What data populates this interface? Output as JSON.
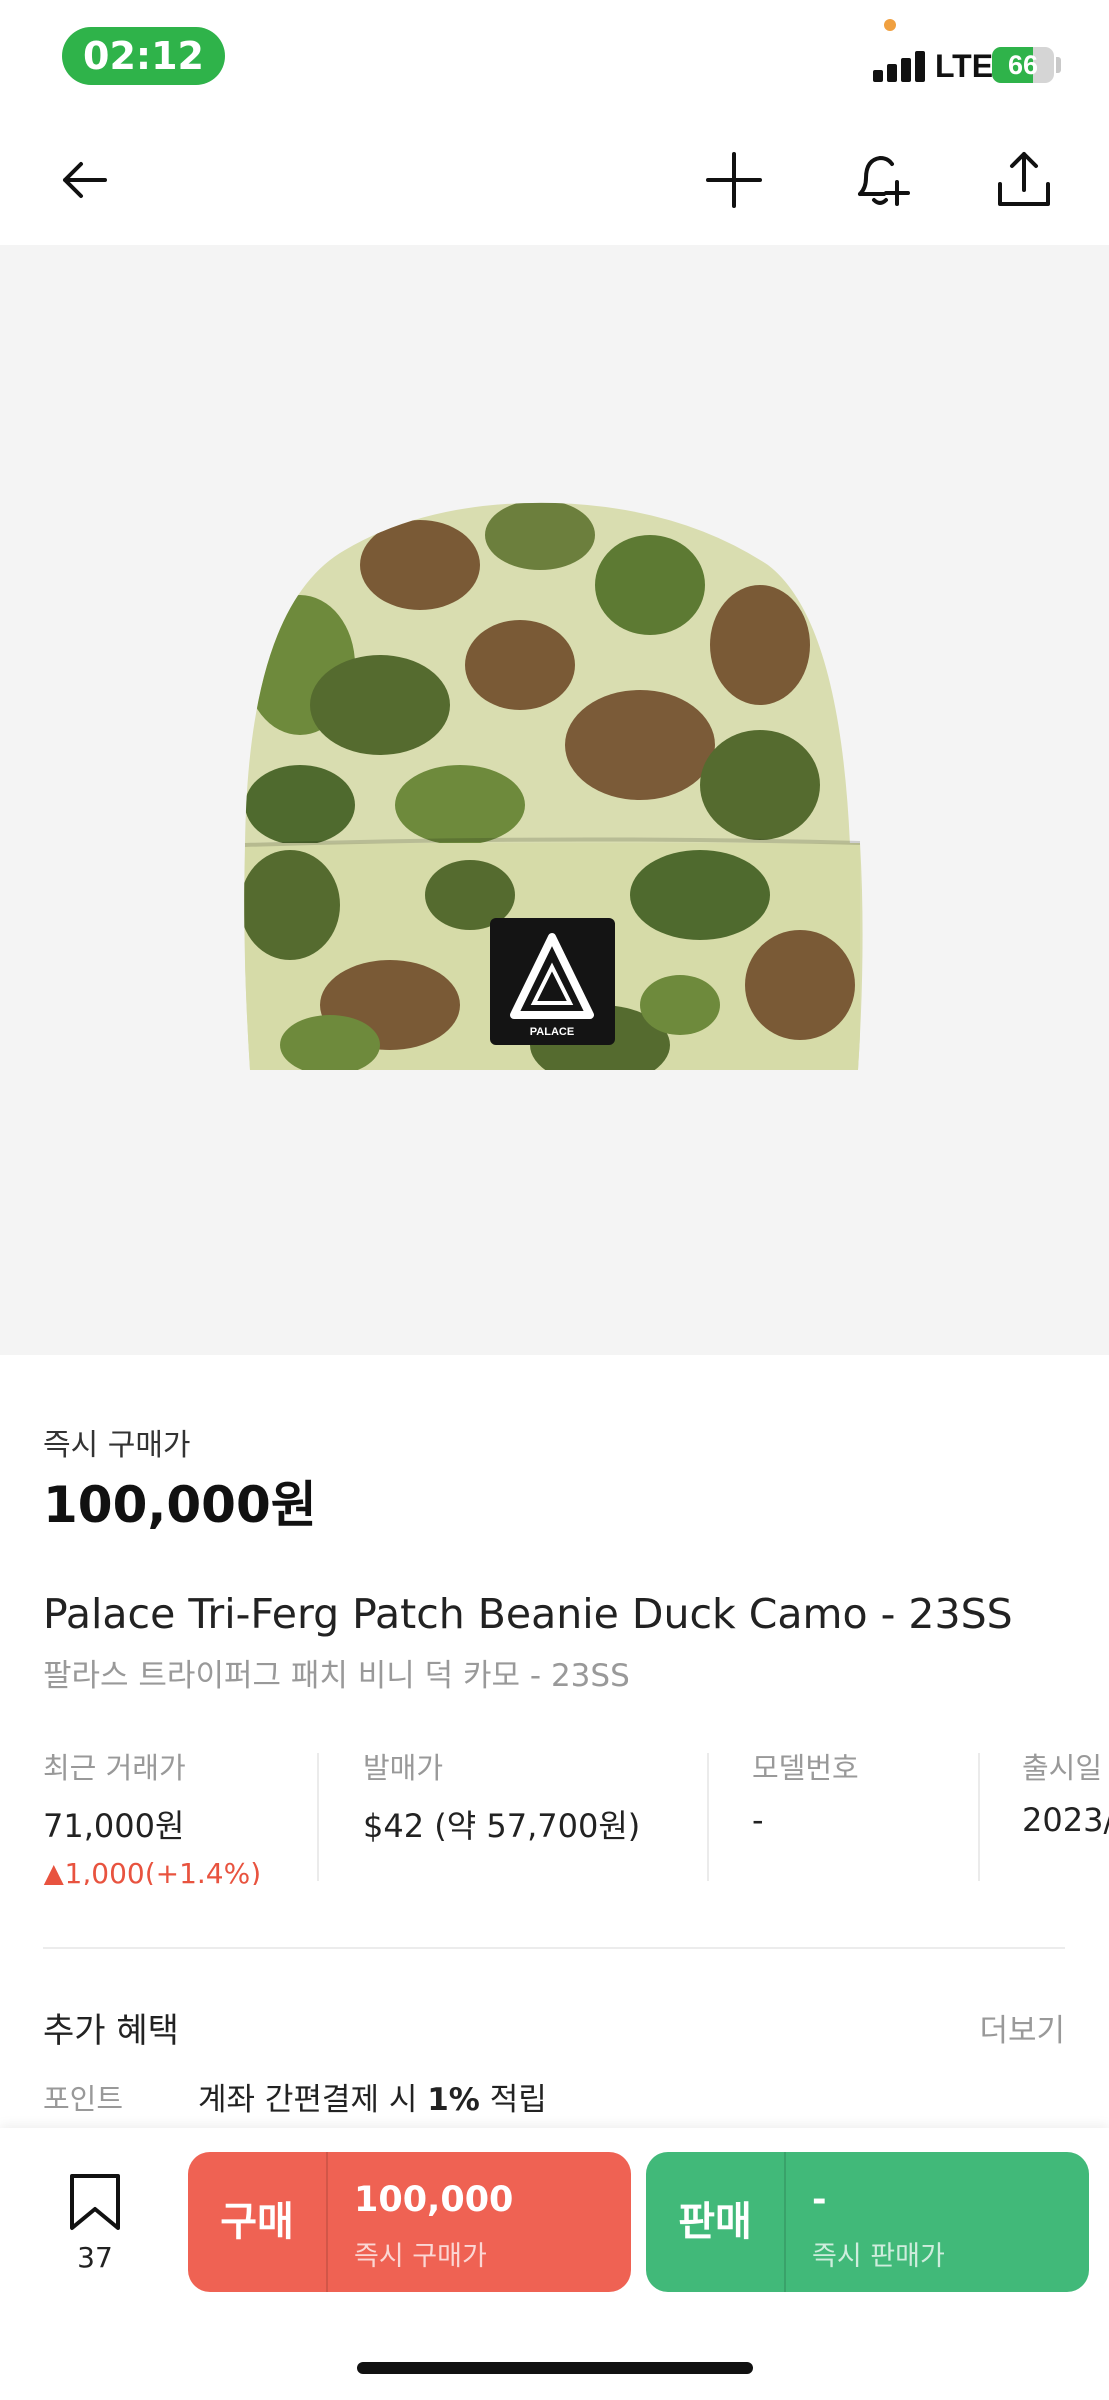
{
  "status_bar": {
    "time": "02:12",
    "network": "LTE",
    "battery_level": "66",
    "battery_fill_percent": 66,
    "accent_color": "#2fb34a"
  },
  "nav": {
    "back_icon": "arrow-left-icon",
    "add_icon": "plus-icon",
    "notify_icon": "bell-plus-icon",
    "share_icon": "share-icon"
  },
  "product": {
    "image_name": "camo-beanie-image",
    "price_label": "즉시 구매가",
    "price": "100,000원",
    "title_en": "Palace Tri-Ferg Patch Beanie Duck Camo - 23SS",
    "title_ko": "팔라스 트라이퍼그 패치 비니 덕 카모 - 23SS",
    "patch_text": "PALACE"
  },
  "info": {
    "recent": {
      "label": "최근 거래가",
      "value": "71,000원",
      "change": "▲1,000(+1.4%)"
    },
    "retail": {
      "label": "발매가",
      "value": "$42 (약 57,700원)"
    },
    "model": {
      "label": "모델번호",
      "value": "-"
    },
    "release": {
      "label": "출시일",
      "value": "2023/"
    }
  },
  "benefits": {
    "title": "추가 혜택",
    "more": "더보기",
    "point_label": "포인트",
    "point_prefix": "계좌 간편결제 시 ",
    "point_bold": "1%",
    "point_suffix": " 적립"
  },
  "bottom": {
    "wish_count": "37",
    "buy": {
      "kind": "구매",
      "amount": "100,000",
      "sub": "즉시 구매가",
      "color": "#ef6253"
    },
    "sell": {
      "kind": "판매",
      "amount": "-",
      "sub": "즉시 판매가",
      "color": "#41b979"
    }
  }
}
